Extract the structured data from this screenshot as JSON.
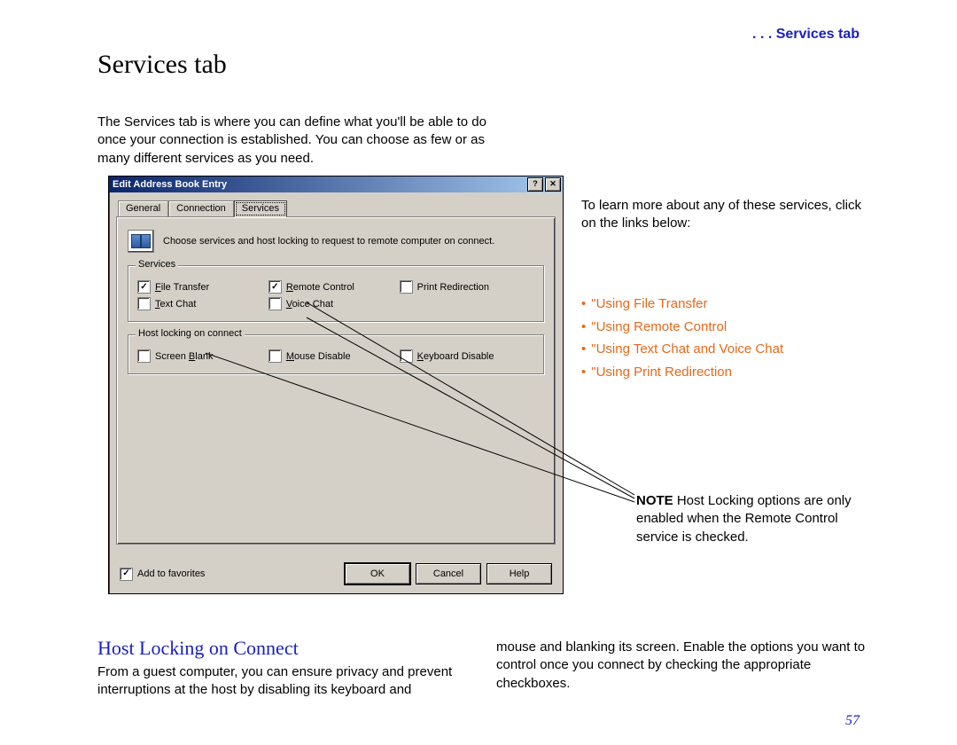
{
  "header": {
    "running": ". . . Services tab"
  },
  "headings": {
    "main": "Services tab",
    "section": "Host Locking on Connect"
  },
  "paragraphs": {
    "intro": "The Services tab is where you can define what you'll be able to do once your connection is established. You can choose as few or as many different services as you need.",
    "learn_more": "To learn more about any of these services, click on the links below:",
    "body_left": "From a guest computer, you can ensure privacy and prevent interruptions at the host by disabling its keyboard and",
    "body_right": "mouse and blanking its screen.  Enable the options you want to control once you connect by checking the appropriate checkboxes."
  },
  "links": [
    "\"Using File Transfer",
    "\"Using Remote Control",
    "\"Using Text Chat and Voice Chat",
    "\"Using Print Redirection"
  ],
  "note": {
    "label": "NOTE",
    "text": " Host Locking options are only enabled when the Remote Control service is checked."
  },
  "page_number": "57",
  "dialog": {
    "title": "Edit Address Book Entry",
    "help_glyph": "?",
    "close_glyph": "✕",
    "tabs": {
      "general": "General",
      "connection": "Connection",
      "services": "Services"
    },
    "instruction": "Choose services and host locking to request to remote computer on connect.",
    "group_services": {
      "legend": "Services",
      "file_transfer": "File Transfer",
      "remote_control": "Remote Control",
      "print_redirection": "Print Redirection",
      "text_chat": "Text Chat",
      "voice_chat": "Voice Chat"
    },
    "group_hostlock": {
      "legend": "Host locking on connect",
      "screen_blank": "Screen Blank",
      "mouse_disable": "Mouse Disable",
      "keyboard_disable": "Keyboard Disable"
    },
    "add_to_favorites": "Add to favorites",
    "buttons": {
      "ok": "OK",
      "cancel": "Cancel",
      "help": "Help"
    }
  }
}
